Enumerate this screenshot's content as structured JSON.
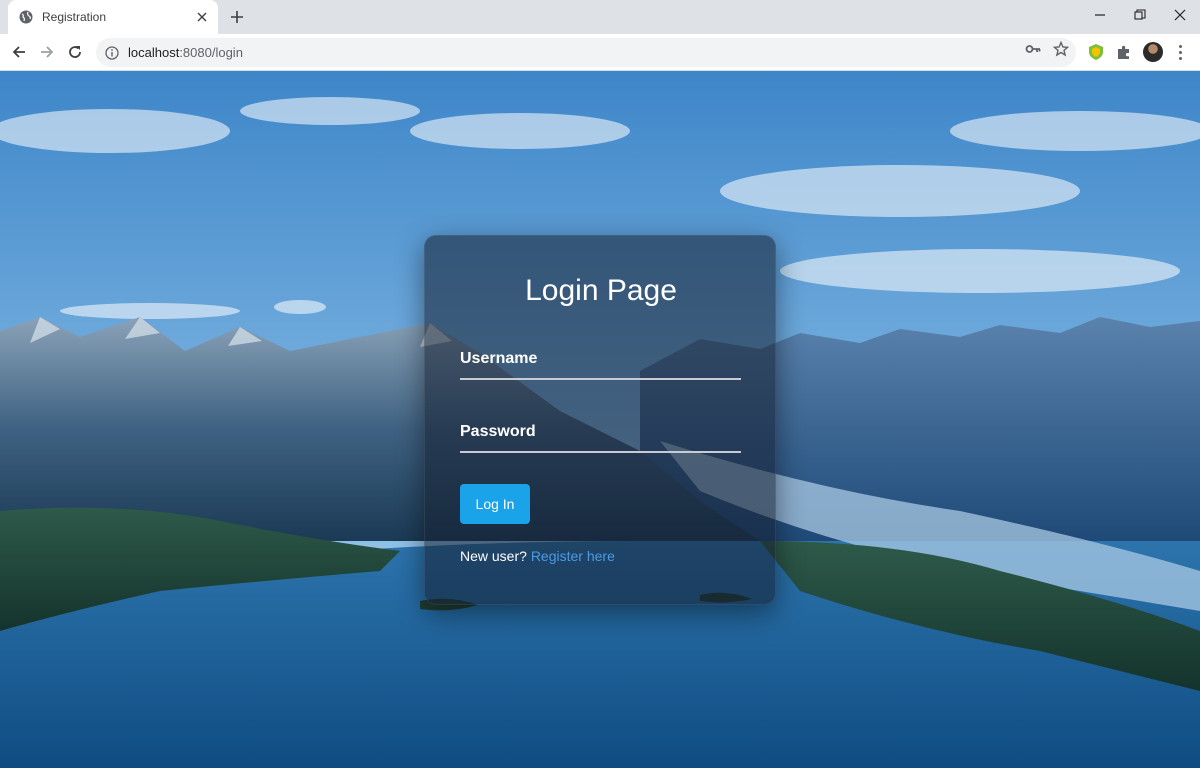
{
  "browser": {
    "tab": {
      "title": "Registration"
    },
    "url": {
      "host": "localhost",
      "port_path": ":8080/login"
    },
    "icons": [
      "globe-icon",
      "close-icon",
      "plus-icon",
      "minimize-icon",
      "restore-icon",
      "window-close-icon",
      "back-arrow-icon",
      "forward-arrow-icon",
      "reload-icon",
      "info-icon",
      "key-icon",
      "star-icon",
      "shield-extension-icon",
      "puzzle-icon",
      "avatar",
      "menu-dots-icon"
    ]
  },
  "login": {
    "title": "Login Page",
    "username_label": "Username",
    "username_value": "",
    "password_label": "Password",
    "password_value": "",
    "button_label": "Log In",
    "new_user_text": "New user?",
    "register_link": "Register here"
  },
  "colors": {
    "button": "#1ba3ea",
    "link": "#4a9be4",
    "card_bg": "rgba(20,30,45,0.55)"
  }
}
